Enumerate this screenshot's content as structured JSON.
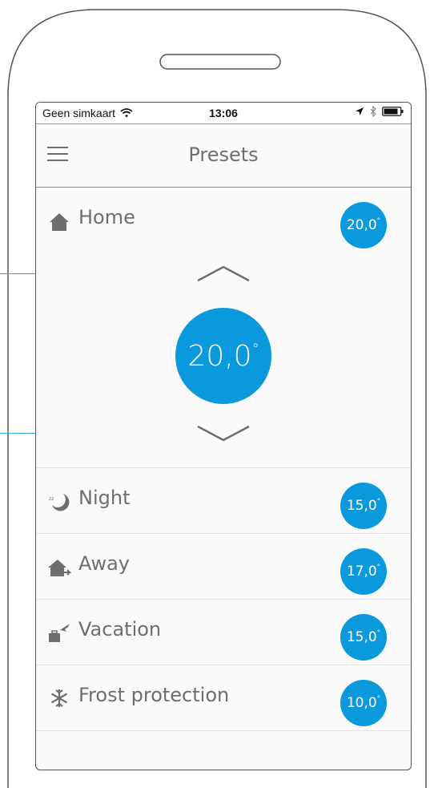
{
  "statusbar": {
    "carrier": "Geen simkaart",
    "time": "13:06"
  },
  "navbar": {
    "title": "Presets"
  },
  "home": {
    "label": "Home",
    "badge": "20,0",
    "value": "20,0"
  },
  "presets": [
    {
      "label": "Night",
      "value": "15,0",
      "icon": "moon-sleep-icon"
    },
    {
      "label": "Away",
      "value": "17,0",
      "icon": "house-exit-icon"
    },
    {
      "label": "Vacation",
      "value": "15,0",
      "icon": "luggage-plane-icon"
    },
    {
      "label": "Frost protection",
      "value": "10,0",
      "icon": "snowflake-icon"
    }
  ],
  "degree_symbol": "°",
  "colors": {
    "accent": "#0a99dc",
    "text": "#6d6e70",
    "callout": "#3aaee0"
  }
}
